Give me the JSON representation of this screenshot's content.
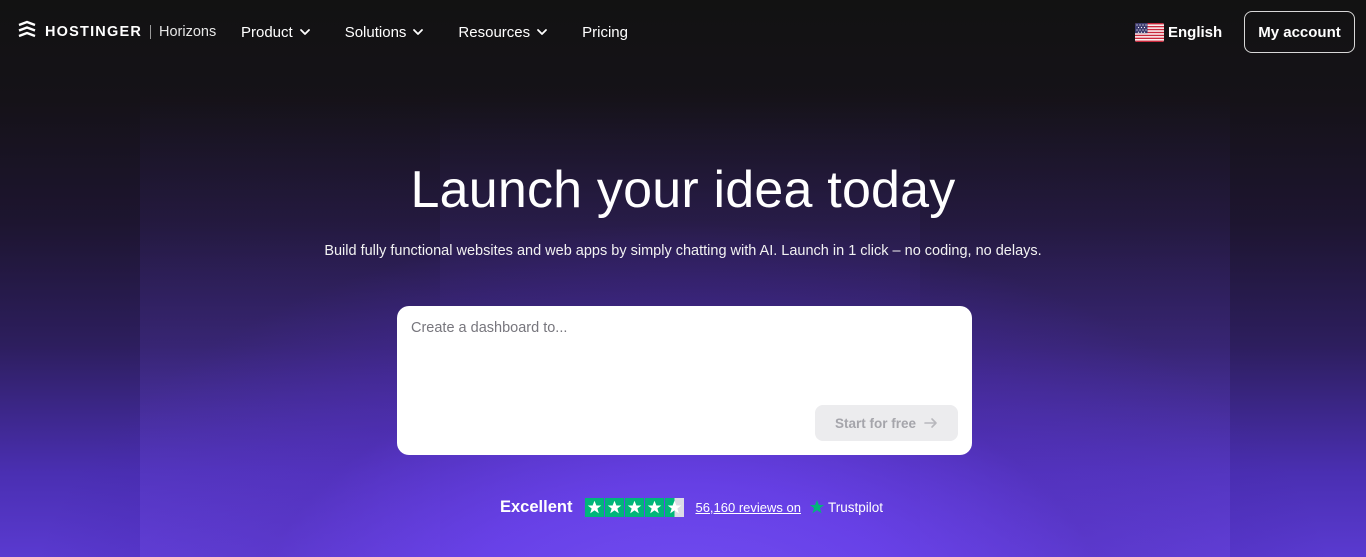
{
  "header": {
    "brand": "HOSTINGER",
    "product": "Horizons",
    "nav": [
      {
        "label": "Product",
        "has_dropdown": true
      },
      {
        "label": "Solutions",
        "has_dropdown": true
      },
      {
        "label": "Resources",
        "has_dropdown": true
      },
      {
        "label": "Pricing",
        "has_dropdown": false
      }
    ],
    "language": {
      "label": "English",
      "flag_icon": "us-flag-icon"
    },
    "account_label": "My account"
  },
  "hero": {
    "title": "Launch your idea today",
    "subtitle": "Build fully functional websites and web apps by simply chatting with AI. Launch in 1 click – no coding, no delays.",
    "prompt": {
      "placeholder": "Create a dashboard to...",
      "value": "",
      "submit_label": "Start for free",
      "submit_icon": "arrow-right-icon"
    }
  },
  "trust": {
    "rating_label": "Excellent",
    "stars": 4.5,
    "reviews_text": "56,160 reviews on",
    "platform": "Trustpilot",
    "star_color": "#00b67a"
  },
  "colors": {
    "background_top": "#121212",
    "background_bottom": "#5a3ad0",
    "button_disabled_bg": "#ececee"
  }
}
